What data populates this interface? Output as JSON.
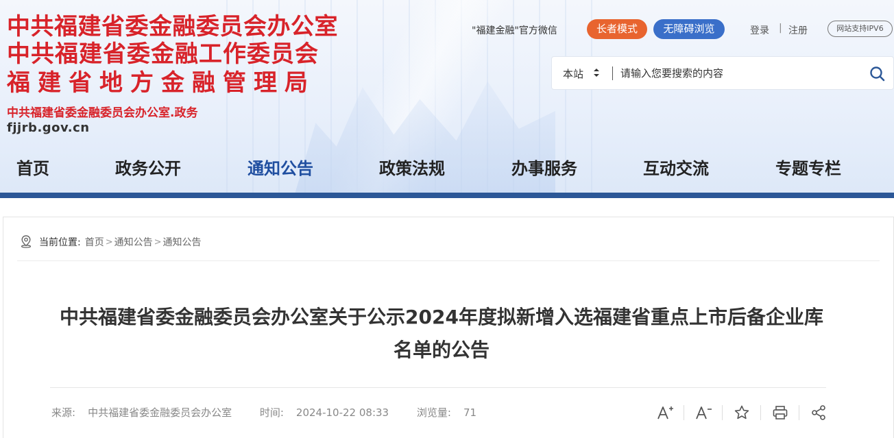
{
  "header": {
    "org_line1": "中共福建省委金融委员会办公室",
    "org_line2": "中共福建省委金融工作委员会",
    "org_line3": "福建省地方金融管理局",
    "org_sub": "中共福建省委金融委员会办公室.政务",
    "domain_red": "fjjrb",
    "domain_rest": ".gov.cn",
    "wechat_label": "\"福建金融\"官方微信",
    "elder_mode": "长者模式",
    "accessible": "无障碍浏览",
    "login": "登录",
    "separator": "|",
    "register": "注册",
    "ipv6": "网站支持IPV6",
    "accent_red": "#d8232a",
    "nav_blue": "#2b5797"
  },
  "search": {
    "scope": "本站",
    "placeholder": "请输入您要搜索的内容",
    "value": ""
  },
  "nav": {
    "items": [
      {
        "label": "首页"
      },
      {
        "label": "政务公开"
      },
      {
        "label": "通知公告",
        "active": true
      },
      {
        "label": "政策法规"
      },
      {
        "label": "办事服务"
      },
      {
        "label": "互动交流"
      },
      {
        "label": "专题专栏"
      }
    ]
  },
  "breadcrumb": {
    "label": "当前位置:",
    "items": [
      "首页",
      "通知公告",
      "通知公告"
    ],
    "sep": ">"
  },
  "article": {
    "title": "中共福建省委金融委员会办公室关于公示2024年度拟新增入选福建省重点上市后备企业库名单的公告",
    "source_label": "来源:",
    "source": "中共福建省委金融委员会办公室",
    "time_label": "时间:",
    "time": "2024-10-22 08:33",
    "views_label": "浏览量:",
    "views": "71"
  },
  "tools": {
    "font_increase": "A+",
    "font_decrease": "A-",
    "favorite": "star-icon",
    "print": "print-icon",
    "share": "share-icon"
  }
}
